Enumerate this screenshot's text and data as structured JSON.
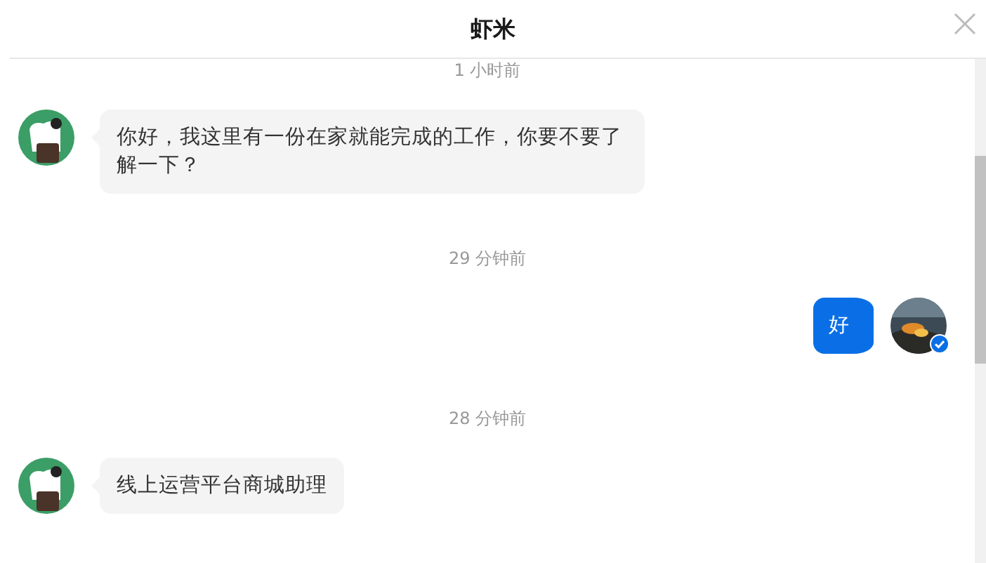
{
  "window": {
    "title": "虾米"
  },
  "messages": [
    {
      "kind": "time",
      "text": "1 小时前"
    },
    {
      "kind": "incoming",
      "text": "你好，我这里有一份在家就能完成的工作，你要不要了解一下？"
    },
    {
      "kind": "time",
      "text": "29 分钟前"
    },
    {
      "kind": "outgoing",
      "text": "好",
      "verified": true
    },
    {
      "kind": "time",
      "text": "28 分钟前"
    },
    {
      "kind": "incoming",
      "text": "线上运营平台商城助理"
    }
  ]
}
